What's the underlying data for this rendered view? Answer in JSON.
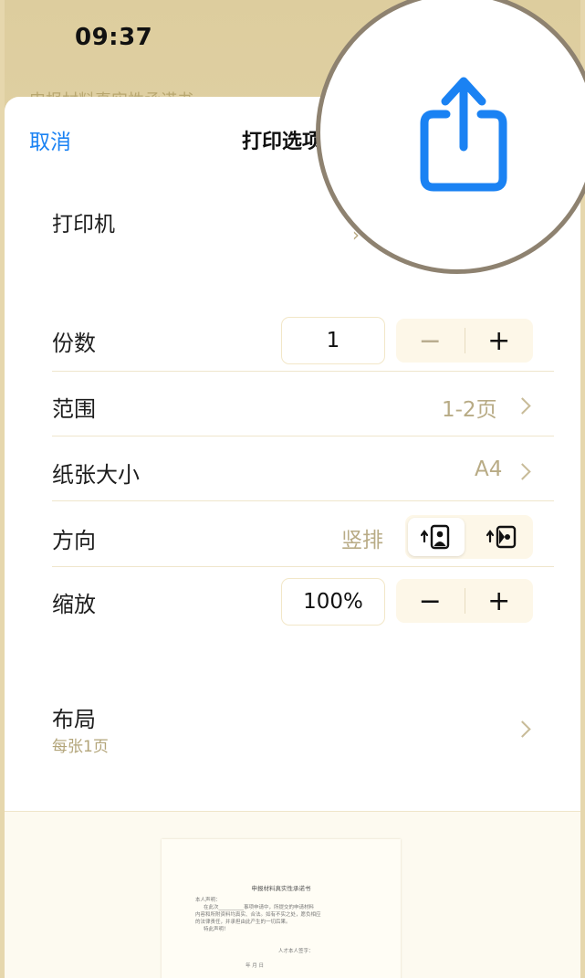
{
  "status_bar": {
    "time": "09:37"
  },
  "background": {
    "title_text": "申报材料真实性承诺书"
  },
  "sheet": {
    "cancel_label": "取消",
    "title": "打印选项"
  },
  "printer": {
    "label": "打印机"
  },
  "copies": {
    "label": "份数",
    "value": "1",
    "minus": "−",
    "plus": "+"
  },
  "range": {
    "label": "范围",
    "value": "1-2页"
  },
  "paper_size": {
    "label": "纸张大小",
    "value": "A4"
  },
  "orientation": {
    "label": "方向",
    "value": "竖排",
    "options": [
      "portrait",
      "landscape"
    ],
    "selected": "portrait"
  },
  "scale": {
    "label": "缩放",
    "value": "100%",
    "minus": "−",
    "plus": "+"
  },
  "layout": {
    "label": "布局",
    "sub": "每张1页"
  },
  "preview": {
    "doc_title": "申报材料真实性承诺书",
    "line1": "本人声明：",
    "line2": "在此次__________事项申请中，所提交的申请材料",
    "line3": "内容和所附资料均真实、合法。如有不实之处，愿负相应",
    "line4": "的法律责任，并承担由此产生的一切后果。",
    "line5": "特此声明！",
    "signature": "人才本人签字：",
    "date": "年 月 日"
  },
  "share_callout": {
    "icon": "share-icon",
    "color": "#1a82f3"
  },
  "colors": {
    "accent": "#1a82f3",
    "secondary_text": "#b8ab85"
  }
}
